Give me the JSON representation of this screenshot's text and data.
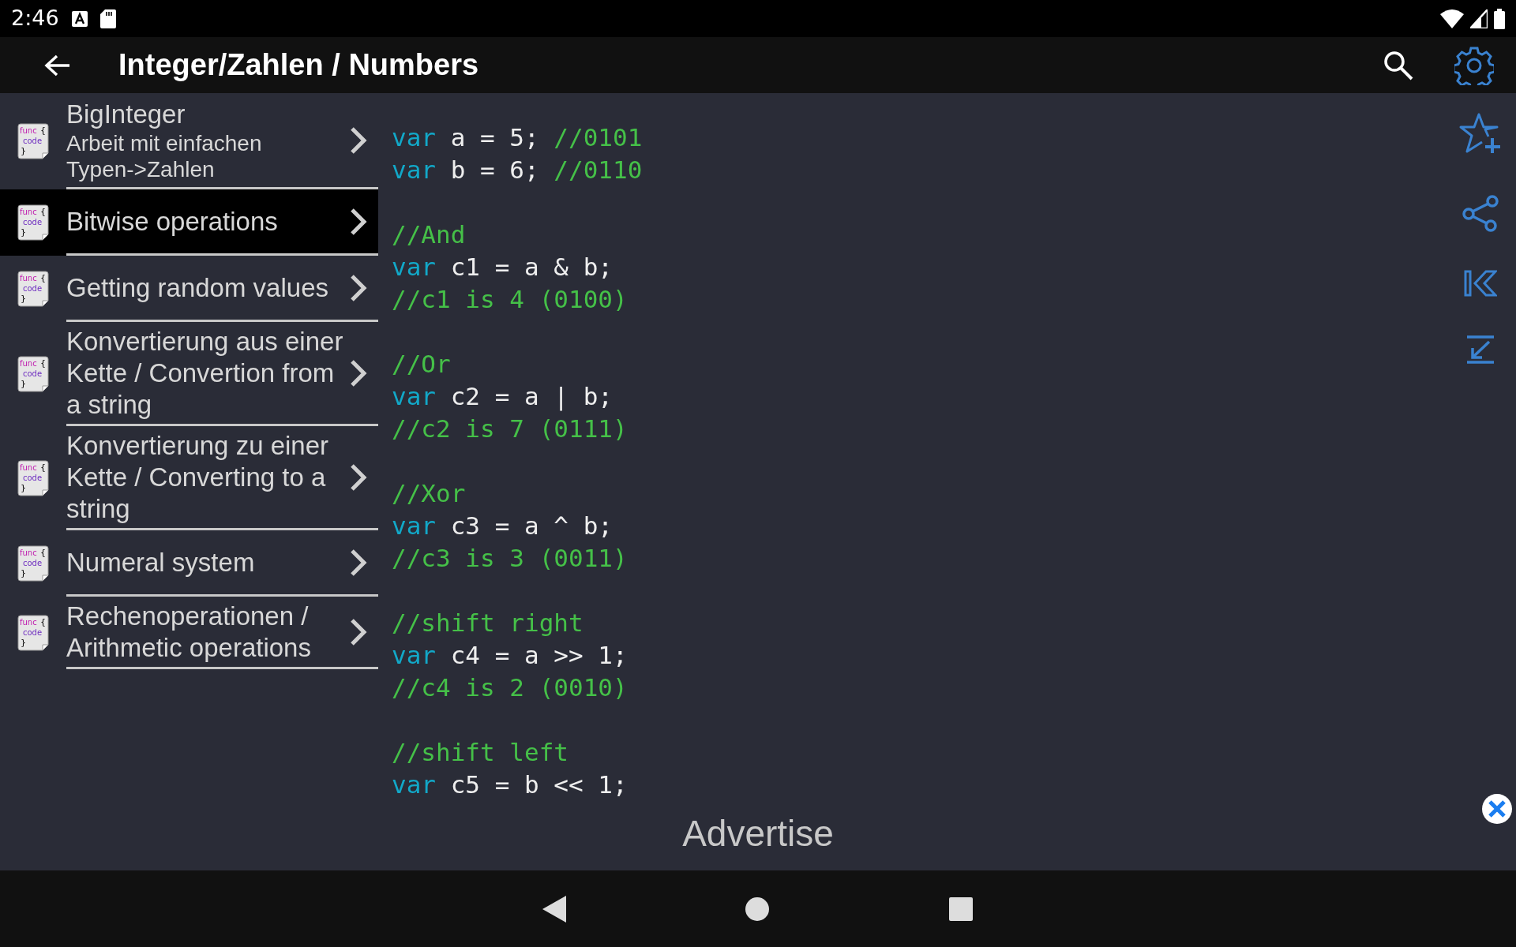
{
  "status_bar": {
    "time": "2:46"
  },
  "app_bar": {
    "title": "Integer/Zahlen / Numbers"
  },
  "topics": [
    {
      "title": "BigInteger",
      "subtitle": "Arbeit mit einfachen Typen->Zahlen",
      "selected": false,
      "icon": {
        "keyword": "func",
        "open": "{",
        "word": "code",
        "close": "}"
      }
    },
    {
      "title": "Bitwise operations",
      "selected": true,
      "icon": {
        "keyword": "func",
        "open": "{",
        "word": "code",
        "close": "}"
      }
    },
    {
      "title": "Getting random values",
      "selected": false,
      "icon": {
        "keyword": "func",
        "open": "{",
        "word": "code",
        "close": "}"
      }
    },
    {
      "title": "Konvertierung aus einer Kette / Convertion from a string",
      "selected": false,
      "icon": {
        "keyword": "func",
        "open": "{",
        "word": "code",
        "close": "}"
      }
    },
    {
      "title": "Konvertierung zu einer Kette / Converting to a string",
      "selected": false,
      "icon": {
        "keyword": "func",
        "open": "{",
        "word": "code",
        "close": "}"
      }
    },
    {
      "title": "Numeral system",
      "selected": false,
      "icon": {
        "keyword": "func",
        "open": "{",
        "word": "code",
        "close": "}"
      }
    },
    {
      "title": "Rechenoperationen / Arithmetic operations",
      "selected": false,
      "icon": {
        "keyword": "func",
        "open": "{",
        "word": "code",
        "close": "}"
      }
    }
  ],
  "code_blocks": [
    [
      [
        {
          "kind": "keyword",
          "text": "var"
        },
        {
          "kind": "plain",
          "text": " a = 5; "
        },
        {
          "kind": "comment",
          "text": "//0101"
        }
      ],
      [
        {
          "kind": "keyword",
          "text": "var"
        },
        {
          "kind": "plain",
          "text": " b = 6; "
        },
        {
          "kind": "comment",
          "text": "//0110"
        }
      ]
    ],
    [
      [
        {
          "kind": "comment",
          "text": "//And"
        }
      ],
      [
        {
          "kind": "keyword",
          "text": "var"
        },
        {
          "kind": "plain",
          "text": " c1 = a & b;"
        }
      ],
      [
        {
          "kind": "comment",
          "text": "//c1 is 4 (0100)"
        }
      ]
    ],
    [
      [
        {
          "kind": "comment",
          "text": "//Or"
        }
      ],
      [
        {
          "kind": "keyword",
          "text": "var"
        },
        {
          "kind": "plain",
          "text": " c2 = a | b;"
        }
      ],
      [
        {
          "kind": "comment",
          "text": "//c2 is 7 (0111)"
        }
      ]
    ],
    [
      [
        {
          "kind": "comment",
          "text": "//Xor"
        }
      ],
      [
        {
          "kind": "keyword",
          "text": "var"
        },
        {
          "kind": "plain",
          "text": " c3 = a ^ b;"
        }
      ],
      [
        {
          "kind": "comment",
          "text": "//c3 is 3 (0011)"
        }
      ]
    ],
    [
      [
        {
          "kind": "comment",
          "text": "//shift right"
        }
      ],
      [
        {
          "kind": "keyword",
          "text": "var"
        },
        {
          "kind": "plain",
          "text": " c4 = a >> 1;"
        }
      ],
      [
        {
          "kind": "comment",
          "text": "//c4 is 2 (0010)"
        }
      ]
    ],
    [
      [
        {
          "kind": "comment",
          "text": "//shift left"
        }
      ],
      [
        {
          "kind": "keyword",
          "text": "var"
        },
        {
          "kind": "plain",
          "text": " c5 = b << 1;"
        }
      ]
    ]
  ],
  "ad_banner": {
    "label": "Advertise"
  }
}
